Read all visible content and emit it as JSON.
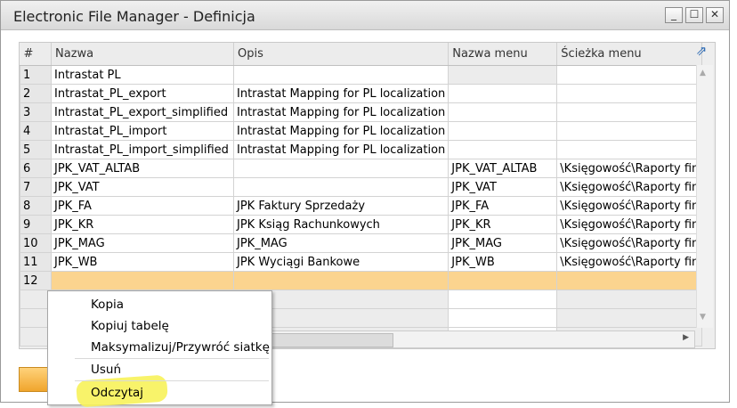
{
  "window": {
    "title": "Electronic File Manager - Definicja",
    "minimize": "_",
    "maximize": "☐",
    "close": "✕"
  },
  "grid": {
    "columns": [
      "#",
      "Nazwa",
      "Opis",
      "Nazwa menu",
      "Ścieżka menu"
    ],
    "rows": [
      [
        "1",
        "Intrastat PL",
        "",
        "",
        ""
      ],
      [
        "2",
        "Intrastat_PL_export",
        "Intrastat Mapping for PL localization",
        "",
        ""
      ],
      [
        "3",
        "Intrastat_PL_export_simplified",
        "Intrastat Mapping for PL localization",
        "",
        ""
      ],
      [
        "4",
        "Intrastat_PL_import",
        "Intrastat Mapping for PL localization",
        "",
        ""
      ],
      [
        "5",
        "Intrastat_PL_import_simplified",
        "Intrastat Mapping for PL localization",
        "",
        ""
      ],
      [
        "6",
        "JPK_VAT_ALTAB",
        "",
        "JPK_VAT_ALTAB",
        "\\Księgowość\\Raporty fin"
      ],
      [
        "7",
        "JPK_VAT",
        "",
        "JPK_VAT",
        "\\Księgowość\\Raporty fin"
      ],
      [
        "8",
        "JPK_FA",
        "JPK Faktury Sprzedaży",
        "JPK_FA",
        "\\Księgowość\\Raporty fin"
      ],
      [
        "9",
        "JPK_KR",
        "JPK Ksiąg Rachunkowych",
        "JPK_KR",
        "\\Księgowość\\Raporty fin"
      ],
      [
        "10",
        "JPK_MAG",
        "JPK_MAG",
        "JPK_MAG",
        "\\Księgowość\\Raporty fin"
      ],
      [
        "11",
        "JPK_WB",
        "JPK Wyciągi Bankowe",
        "JPK_WB",
        "\\Księgowość\\Raporty fin"
      ],
      [
        "12",
        "",
        "",
        "",
        ""
      ]
    ],
    "selected_row": 12
  },
  "context_menu": {
    "items": [
      "Kopia",
      "Kopiuj tabelę",
      "Maksymalizuj/Przywróć siatkę",
      "Usuń",
      "Odczytaj"
    ]
  },
  "icons": {
    "expand": "expand-arrow-icon",
    "scroll_up": "▲",
    "scroll_down": "▼",
    "scroll_right": "▶"
  }
}
